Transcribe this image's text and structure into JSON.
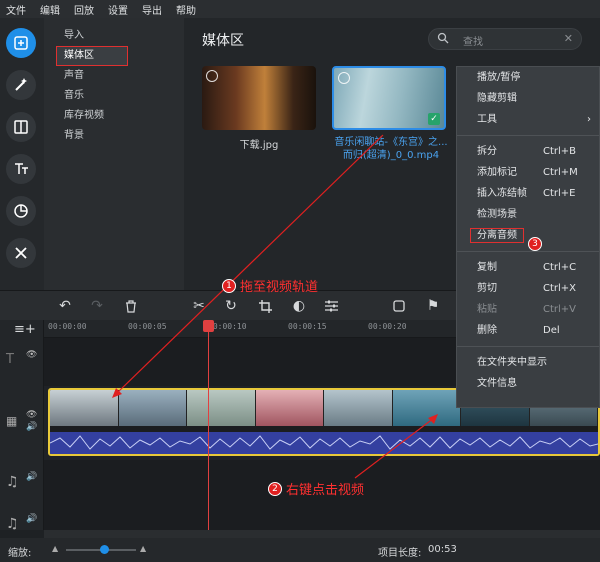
{
  "menu": [
    "文件",
    "编辑",
    "回放",
    "设置",
    "导出",
    "帮助"
  ],
  "subnav": {
    "items": [
      "导入",
      "媒体区",
      "声音",
      "音乐",
      "库存视频",
      "背景"
    ],
    "selected_index": 1
  },
  "rail_icons": [
    "add-media-icon",
    "magic-wand-icon",
    "transitions-icon",
    "text-icon",
    "stickers-icon",
    "tools-icon"
  ],
  "media": {
    "title": "媒体区",
    "search_placeholder": "查找",
    "items": [
      {
        "name": "下载.jpg",
        "type": "image"
      },
      {
        "name": "音乐闲聊站-《东宫》之...而归(超清)_0_0.mp4",
        "type": "video",
        "selected": true
      }
    ]
  },
  "context_menu": {
    "items": [
      {
        "label": "播放/暂停",
        "shortcut": ""
      },
      {
        "label": "隐藏剪辑",
        "shortcut": ""
      },
      {
        "label": "工具",
        "shortcut": "",
        "submenu": true
      },
      {
        "separator": true
      },
      {
        "label": "拆分",
        "shortcut": "Ctrl+B"
      },
      {
        "label": "添加标记",
        "shortcut": "Ctrl+M"
      },
      {
        "label": "插入冻结帧",
        "shortcut": "Ctrl+E"
      },
      {
        "label": "检测场景",
        "shortcut": ""
      },
      {
        "label": "分离音频",
        "shortcut": "",
        "highlighted": true
      },
      {
        "separator": true
      },
      {
        "label": "复制",
        "shortcut": "Ctrl+C"
      },
      {
        "label": "剪切",
        "shortcut": "Ctrl+X"
      },
      {
        "label": "粘贴",
        "shortcut": "Ctrl+V",
        "disabled": true
      },
      {
        "label": "删除",
        "shortcut": "Del"
      },
      {
        "separator": true
      },
      {
        "label": "在文件夹中显示",
        "shortcut": ""
      },
      {
        "label": "文件信息",
        "shortcut": ""
      }
    ]
  },
  "ruler": {
    "ticks": [
      "00:00:00",
      "00:00:05",
      "00:00:10",
      "00:00:15",
      "00:00:20"
    ]
  },
  "annotations": {
    "a1": {
      "num": "1",
      "text": "拖至视频轨道"
    },
    "a2": {
      "num": "2",
      "text": "右键点击视频"
    },
    "a3": {
      "num": "3"
    }
  },
  "bottom": {
    "zoom_label": "缩放:",
    "project_length_label": "项目长度:",
    "project_length": "00:53"
  },
  "colors": {
    "accent": "#1f8fe8",
    "annotation": "#ff3030",
    "clip_border": "#e8c93a",
    "waveform": "#3440a0"
  }
}
